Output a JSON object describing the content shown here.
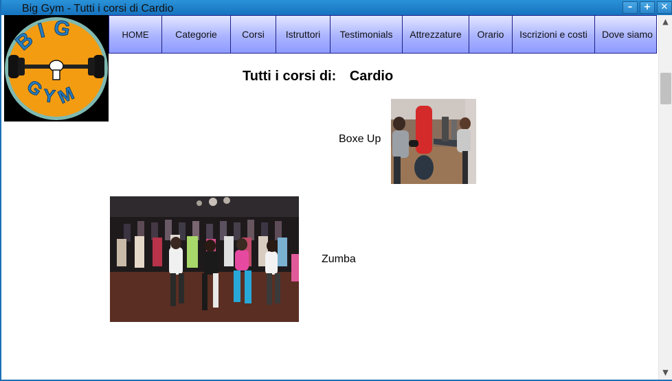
{
  "window": {
    "title": "Big Gym - Tutti i corsi di Cardio",
    "controls": {
      "minimize": "–",
      "maximize": "+",
      "close": "✕"
    }
  },
  "logo": {
    "text": "BIG GYM",
    "alt_icon": "barbell-logo-icon"
  },
  "nav": {
    "items": [
      {
        "label": "HOME"
      },
      {
        "label": "Categorie"
      },
      {
        "label": "Corsi"
      },
      {
        "label": "Istruttori"
      },
      {
        "label": "Testimonials"
      },
      {
        "label": "Attrezzature"
      },
      {
        "label": "Orario"
      },
      {
        "label": "Iscrizioni e costi"
      },
      {
        "label": "Dove siamo"
      }
    ]
  },
  "main": {
    "heading_label": "Tutti i corsi di:",
    "heading_category": "Cardio",
    "courses": [
      {
        "name": "Boxe Up",
        "image": "kickboxing-class-photo"
      },
      {
        "name": "Zumba",
        "image": "zumba-class-photo"
      }
    ]
  },
  "scrollbar": {
    "up": "▲",
    "down": "▼"
  },
  "colors": {
    "titlebar": "#1673bf",
    "nav_gradient_top": "#e3e7ff",
    "nav_gradient_bottom": "#8e9cff",
    "nav_border": "#1d1d8a",
    "logo_orange": "#f39c12",
    "logo_blue": "#2a7fc1"
  }
}
